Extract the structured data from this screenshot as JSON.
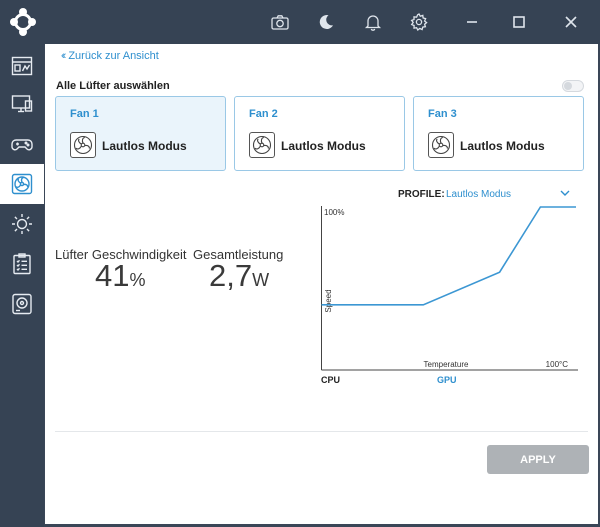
{
  "titlebar": {
    "icons": [
      "logo-icon",
      "camera-icon",
      "moon-icon",
      "bell-icon",
      "gear-icon",
      "minimize-icon",
      "maximize-icon",
      "close-icon"
    ]
  },
  "sidebar": {
    "items": [
      {
        "icon": "dashboard-icon",
        "active": false
      },
      {
        "icon": "monitor-icon",
        "active": false
      },
      {
        "icon": "gamepad-icon",
        "active": false
      },
      {
        "icon": "fan-icon",
        "active": true
      },
      {
        "icon": "sun-icon",
        "active": false
      },
      {
        "icon": "checklist-icon",
        "active": false
      },
      {
        "icon": "disk-icon",
        "active": false
      }
    ]
  },
  "main": {
    "back_link": "Zurück zur Ansicht",
    "select_all_label": "Alle Lüfter auswählen",
    "fans": [
      {
        "title": "Fan 1",
        "mode": "Lautlos Modus",
        "selected": true
      },
      {
        "title": "Fan 2",
        "mode": "Lautlos Modus",
        "selected": false
      },
      {
        "title": "Fan 3",
        "mode": "Lautlos Modus",
        "selected": false
      }
    ],
    "speed": {
      "label": "Lüfter Geschwindigkeit",
      "value": "41",
      "unit": "%"
    },
    "power": {
      "label": "Gesamtleistung",
      "value": "2,7",
      "unit": "W"
    },
    "profile": {
      "label": "PROFILE:",
      "value": "Lautlos Modus"
    },
    "sources": {
      "cpu": "CPU",
      "gpu": "GPU"
    },
    "apply_label": "APPLY"
  },
  "colors": {
    "accent": "#2e8fce",
    "sidebar": "#364354",
    "apply": "#aeb2b6"
  },
  "chart_data": {
    "type": "line",
    "title": "",
    "xlabel": "Temperature",
    "ylabel": "Speed",
    "x_tick_labels": [
      "100°C"
    ],
    "y_tick_labels": [
      "100%"
    ],
    "xlim": [
      0,
      100
    ],
    "ylim": [
      0,
      100
    ],
    "series": [
      {
        "x": [
          0,
          40,
          70,
          86,
          100
        ],
        "y": [
          40,
          40,
          60,
          100,
          100
        ]
      }
    ],
    "grid": false,
    "legend": "none"
  }
}
